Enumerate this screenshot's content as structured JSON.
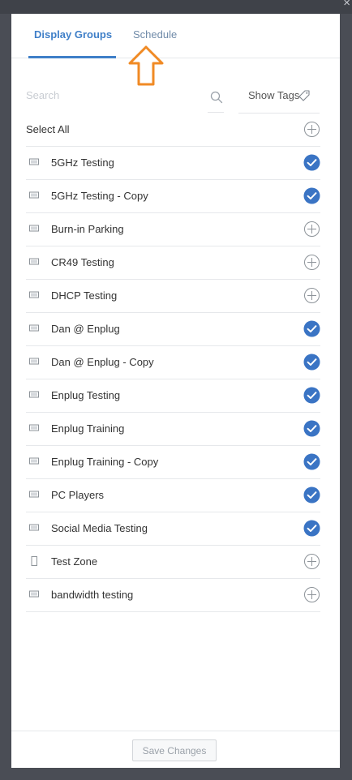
{
  "tabs": [
    {
      "label": "Display Groups",
      "active": true
    },
    {
      "label": "Schedule",
      "active": false
    }
  ],
  "search": {
    "placeholder": "Search",
    "value": ""
  },
  "show_tags_label": "Show Tags",
  "select_all_label": "Select All",
  "groups": [
    {
      "name": "5GHz Testing",
      "selected": true,
      "device": "landscape"
    },
    {
      "name": "5GHz Testing - Copy",
      "selected": true,
      "device": "landscape"
    },
    {
      "name": "Burn-in Parking",
      "selected": false,
      "device": "landscape"
    },
    {
      "name": "CR49 Testing",
      "selected": false,
      "device": "landscape"
    },
    {
      "name": "DHCP Testing",
      "selected": false,
      "device": "landscape"
    },
    {
      "name": "Dan @ Enplug",
      "selected": true,
      "device": "landscape"
    },
    {
      "name": "Dan @ Enplug - Copy",
      "selected": true,
      "device": "landscape"
    },
    {
      "name": "Enplug Testing",
      "selected": true,
      "device": "landscape"
    },
    {
      "name": "Enplug Training",
      "selected": true,
      "device": "landscape"
    },
    {
      "name": "Enplug Training - Copy",
      "selected": true,
      "device": "landscape"
    },
    {
      "name": "PC Players",
      "selected": true,
      "device": "landscape"
    },
    {
      "name": "Social Media Testing",
      "selected": true,
      "device": "landscape"
    },
    {
      "name": "Test Zone",
      "selected": false,
      "device": "portrait"
    },
    {
      "name": "bandwidth testing",
      "selected": false,
      "device": "landscape"
    }
  ],
  "save_label": "Save Changes",
  "colors": {
    "accent": "#3f7fc8",
    "arrow": "#f08a24",
    "check": "#3a74c4"
  },
  "icons": {
    "close": "close-icon",
    "search": "search-icon",
    "tag": "tag-icon",
    "add": "plus-circle-icon",
    "selected": "check-circle-icon",
    "display": "display-icon"
  }
}
